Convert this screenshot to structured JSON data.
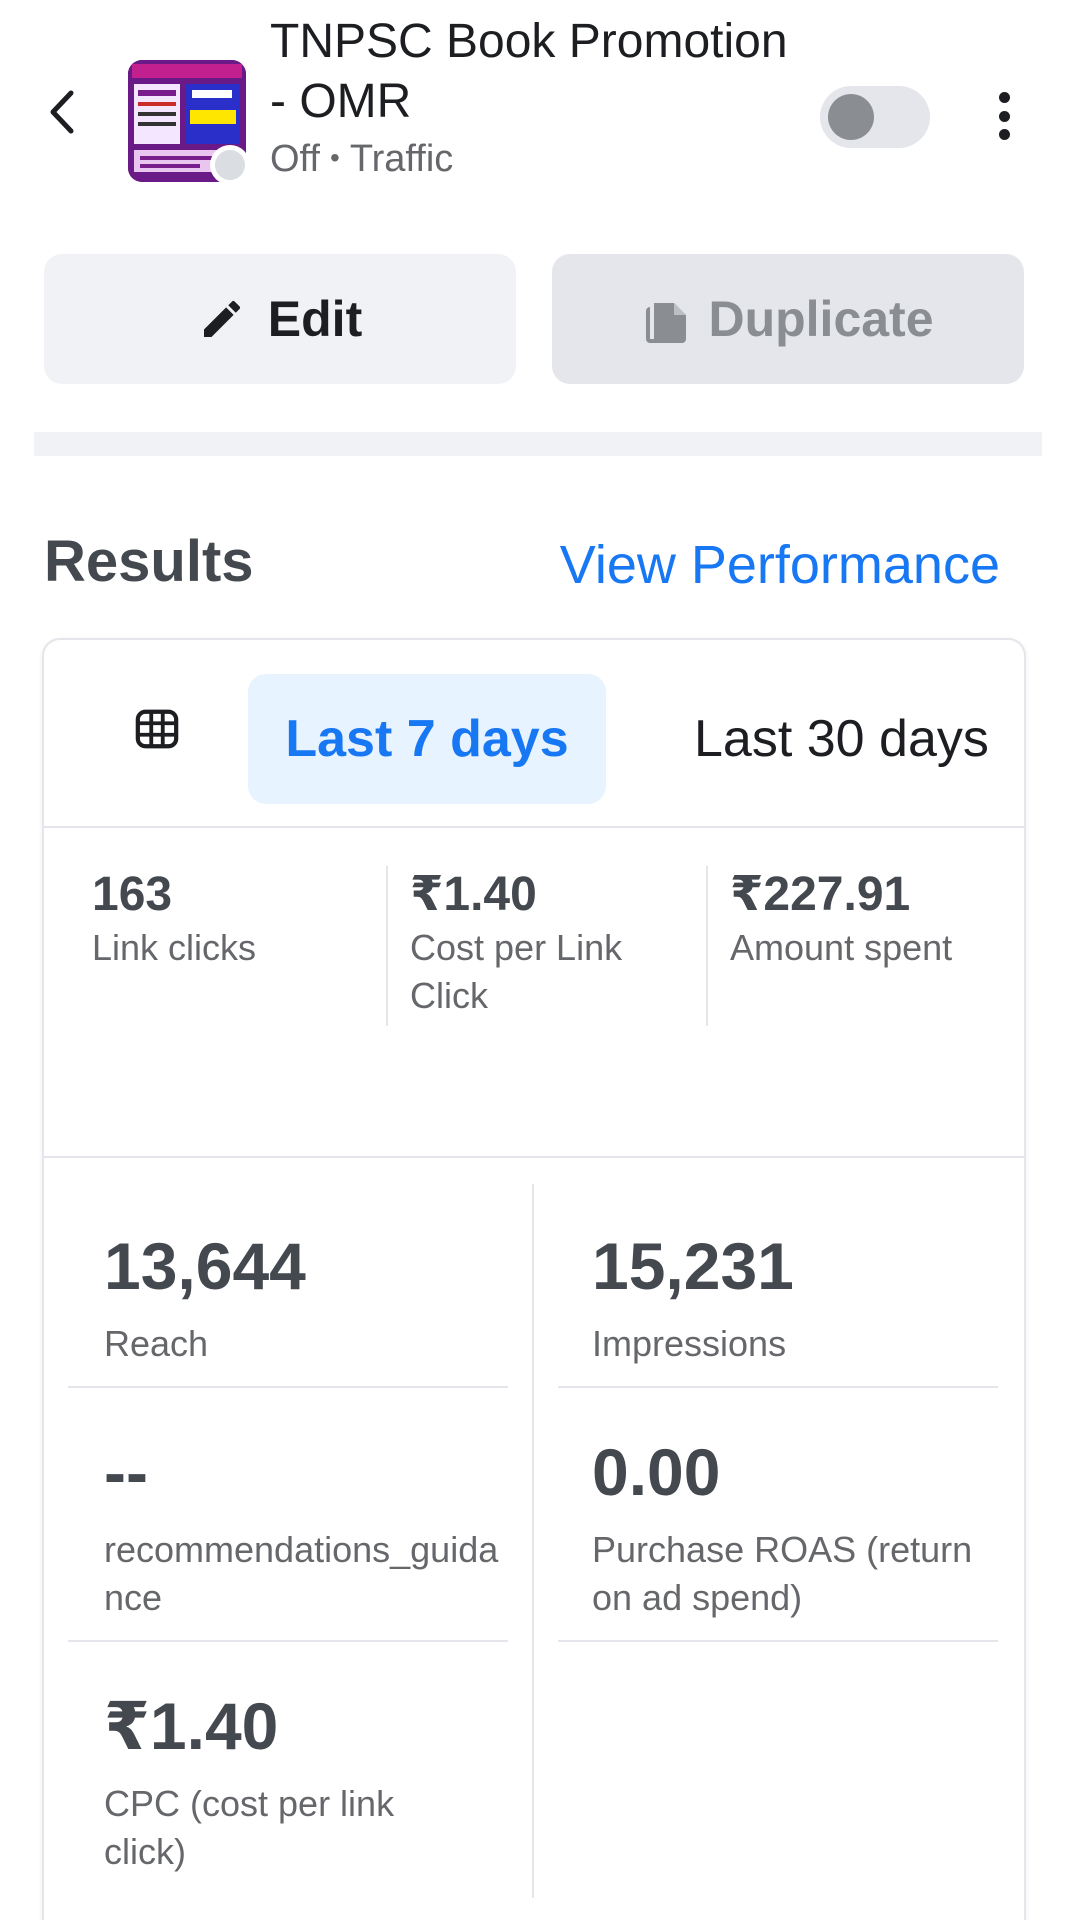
{
  "header": {
    "title": "TNPSC Book Promotion - OMR",
    "status": "Off",
    "separator": "•",
    "objective": "Traffic"
  },
  "actions": {
    "edit_label": "Edit",
    "duplicate_label": "Duplicate"
  },
  "results": {
    "title": "Results",
    "view_performance": "View Performance",
    "tabs": {
      "active": "Last 7 days",
      "other": "Last 30 days"
    },
    "summary": [
      {
        "value": "163",
        "label": "Link clicks"
      },
      {
        "value": "₹1.40",
        "label": "Cost per Link Click"
      },
      {
        "value": "₹227.91",
        "label": "Amount spent"
      }
    ],
    "grid": {
      "reach": {
        "value": "13,644",
        "label": "Reach"
      },
      "impressions": {
        "value": "15,231",
        "label": "Impressions"
      },
      "guidance": {
        "value": "--",
        "label": "recommendations_guidance"
      },
      "roas": {
        "value": "0.00",
        "label": "Purchase ROAS (return on ad spend)"
      },
      "cpc": {
        "value": "₹1.40",
        "label": "CPC (cost per link click)"
      }
    }
  },
  "colors": {
    "accent": "#1877f2",
    "active_tab_bg": "#e7f3ff"
  }
}
